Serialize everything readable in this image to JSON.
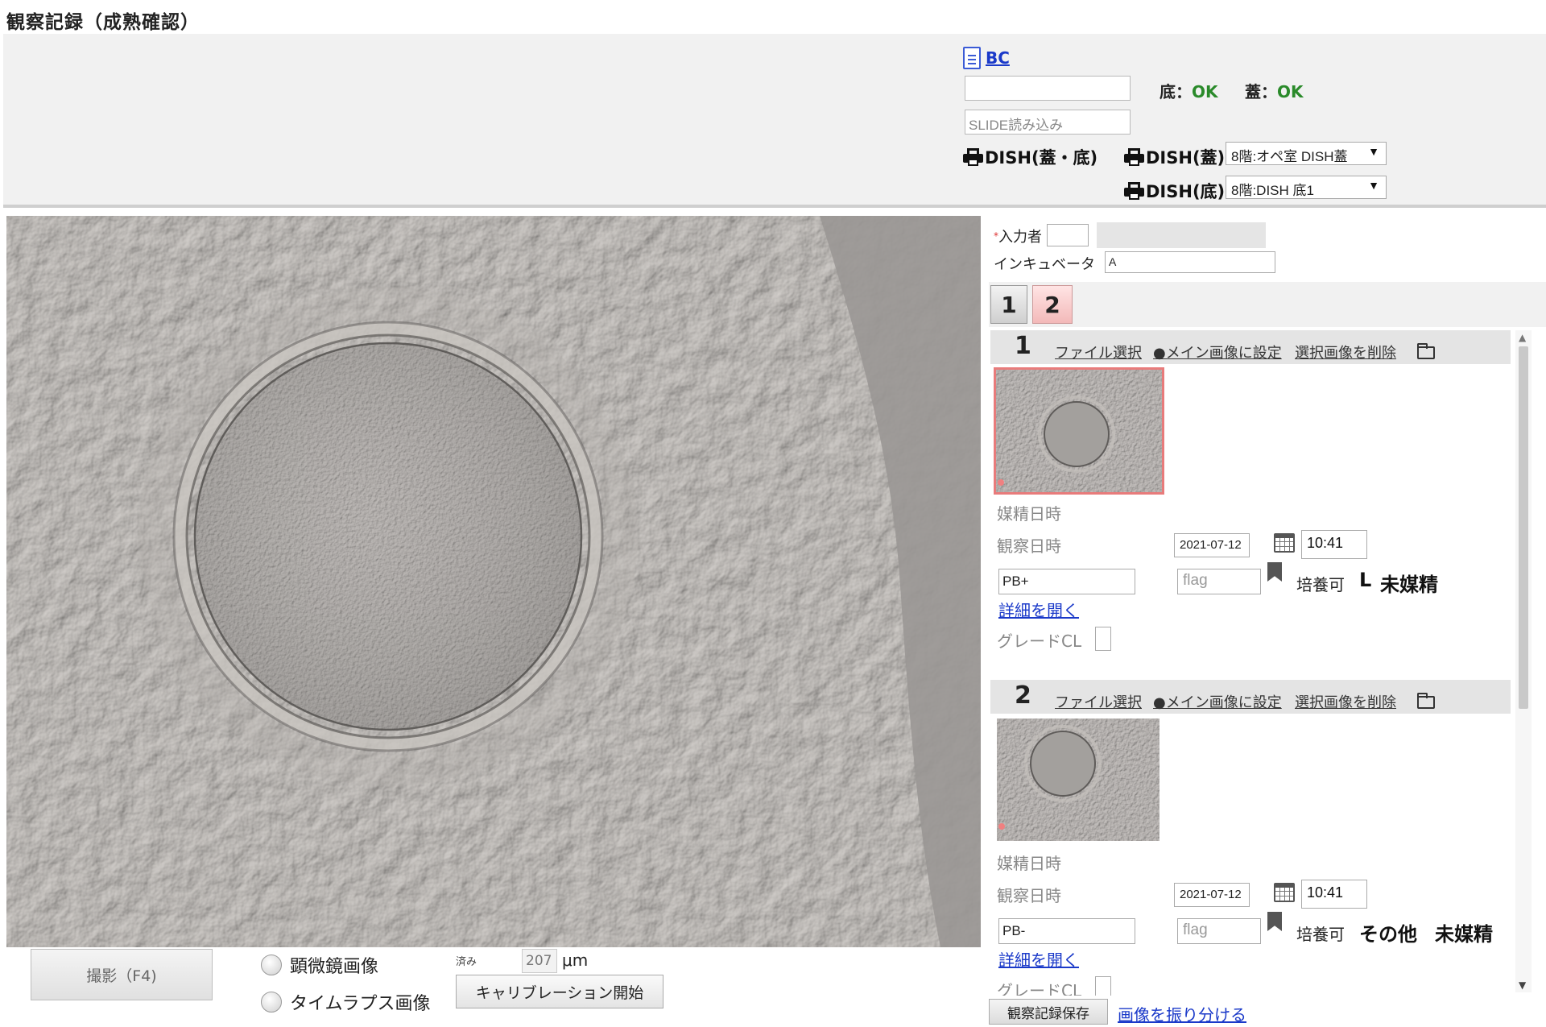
{
  "title": "観察記録（成熟確認）",
  "header": {
    "doc_link": "BC",
    "barcode_input": "",
    "slide_placeholder": "SLIDE読み込み",
    "bottom_label": "底：",
    "bottom_status": "OK",
    "lid_label": "蓋：",
    "lid_status": "OK",
    "print_dish_both": "DISH(蓋・底)",
    "print_dish_lid": "DISH(蓋)",
    "print_dish_bottom": "DISH(底)",
    "lid_printer_select": "8階:オペ室 DISH蓋",
    "bottom_printer_select": "8階:DISH 底1",
    "status_color": "#2a8a2a"
  },
  "controls": {
    "capture_button": "撮影（F4)",
    "radio_microscope": "顕微鏡画像",
    "radio_timelapse": "タイムラプス画像",
    "done_label": "済み",
    "calibration_value": "207",
    "calibration_unit": "μm",
    "calibration_button": "キャリブレーション開始"
  },
  "right": {
    "required_mark": "*",
    "operator_label": "入力者",
    "operator_value": "",
    "incubator_label": "インキュベータ",
    "incubator_value": "A",
    "tabs": [
      "1",
      "2"
    ],
    "records": [
      {
        "number": "1",
        "file_select": "ファイル選択",
        "set_main": "●メイン画像に設定",
        "delete_selected": "選択画像を削除",
        "insemination_label": "媒精日時",
        "observation_label": "観察日時",
        "date": "2021-07-12",
        "time": "10:41",
        "stage": "PB+",
        "flag_placeholder": "flag",
        "culture_label": "培養可",
        "side": "L",
        "status": "未媒精",
        "detail_link": "詳細を開く",
        "grade_label": "グレードCL"
      },
      {
        "number": "2",
        "file_select": "ファイル選択",
        "set_main": "●メイン画像に設定",
        "delete_selected": "選択画像を削除",
        "insemination_label": "媒精日時",
        "observation_label": "観察日時",
        "date": "2021-07-12",
        "time": "10:41",
        "stage": "PB-",
        "flag_placeholder": "flag",
        "culture_label": "培養可",
        "side": "その他",
        "status": "未媒精",
        "detail_link": "詳細を開く",
        "grade_label": "グレードCL"
      }
    ]
  },
  "footer": {
    "save_button": "観察記録保存",
    "sort_link": "画像を振り分ける"
  }
}
